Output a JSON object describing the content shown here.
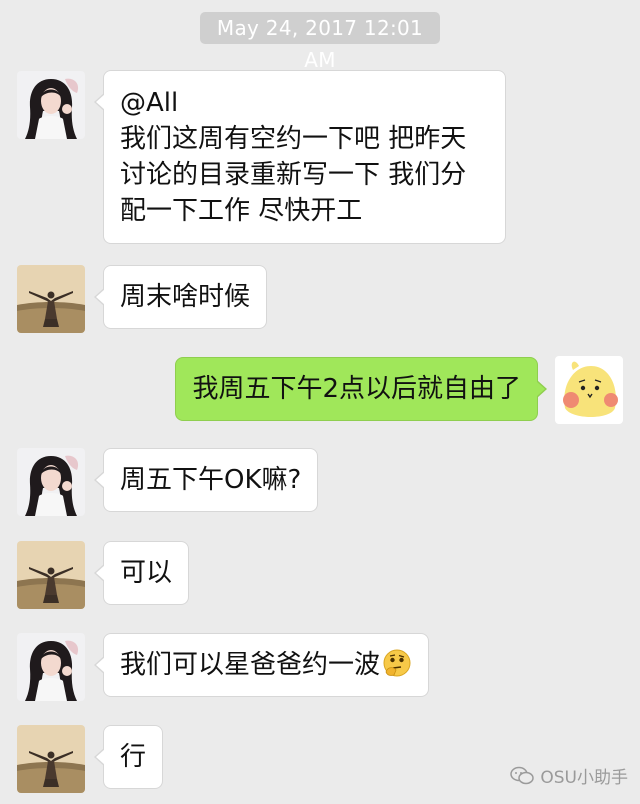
{
  "timestamp": "May 24, 2017 12:01 AM",
  "messages": [
    {
      "sender": "girl",
      "side": "left",
      "lines": [
        "@All",
        "我们这周有空约一下吧 把昨天",
        "讨论的目录重新写一下 我们分",
        "配一下工作 尽快开工"
      ]
    },
    {
      "sender": "man",
      "side": "left",
      "text": "周末啥时候"
    },
    {
      "sender": "me",
      "side": "right",
      "text": "我周五下午2点以后就自由了"
    },
    {
      "sender": "girl",
      "side": "left",
      "text": "周五下午OK嘛?"
    },
    {
      "sender": "man",
      "side": "left",
      "text": "可以"
    },
    {
      "sender": "girl",
      "side": "left",
      "text": "我们可以星爸爸约一波",
      "emoji": "thinking-face-emoji"
    },
    {
      "sender": "man",
      "side": "left",
      "text": "行"
    }
  ],
  "watermark": {
    "text": "OSU小助手",
    "icon": "wechat-icon"
  },
  "colors": {
    "background": "#ebebeb",
    "bubble_left": "#ffffff",
    "bubble_right": "#a0e75a",
    "timestamp_bg": "#cfcfcf"
  }
}
